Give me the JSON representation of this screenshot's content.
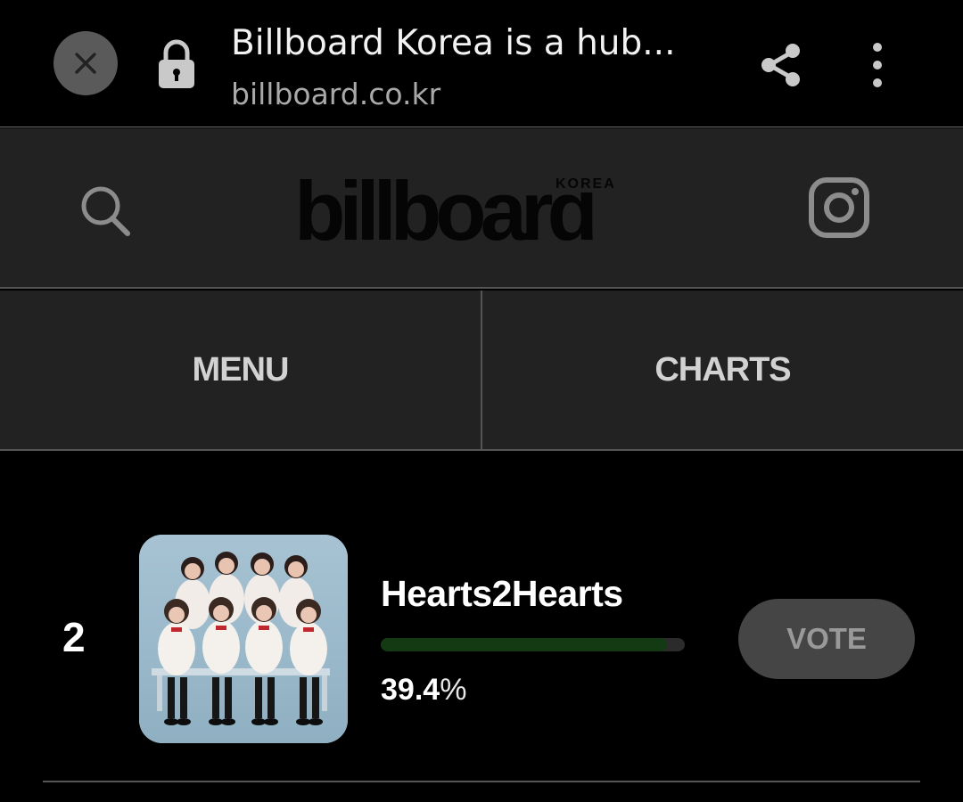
{
  "browser": {
    "page_title": "Billboard Korea is a hub...",
    "url": "billboard.co.kr",
    "icons": [
      "close-icon",
      "lock-icon",
      "share-icon",
      "more-vert-icon"
    ]
  },
  "header": {
    "logo_text": "billboard",
    "logo_subtext": "KOREA",
    "icons": [
      "search-icon",
      "instagram-icon"
    ]
  },
  "nav": {
    "menu_label": "MENU",
    "charts_label": "CHARTS"
  },
  "chart_entry": {
    "rank": "2",
    "artist": "Hearts2Hearts",
    "vote_percent_value": "39.4",
    "vote_percent_unit": "%",
    "vote_fraction": 0.94,
    "vote_label": "VOTE"
  },
  "colors": {
    "background": "#000000",
    "header_bg": "#222222",
    "progress_fill": "#143a14",
    "vote_button_bg": "#454545"
  }
}
